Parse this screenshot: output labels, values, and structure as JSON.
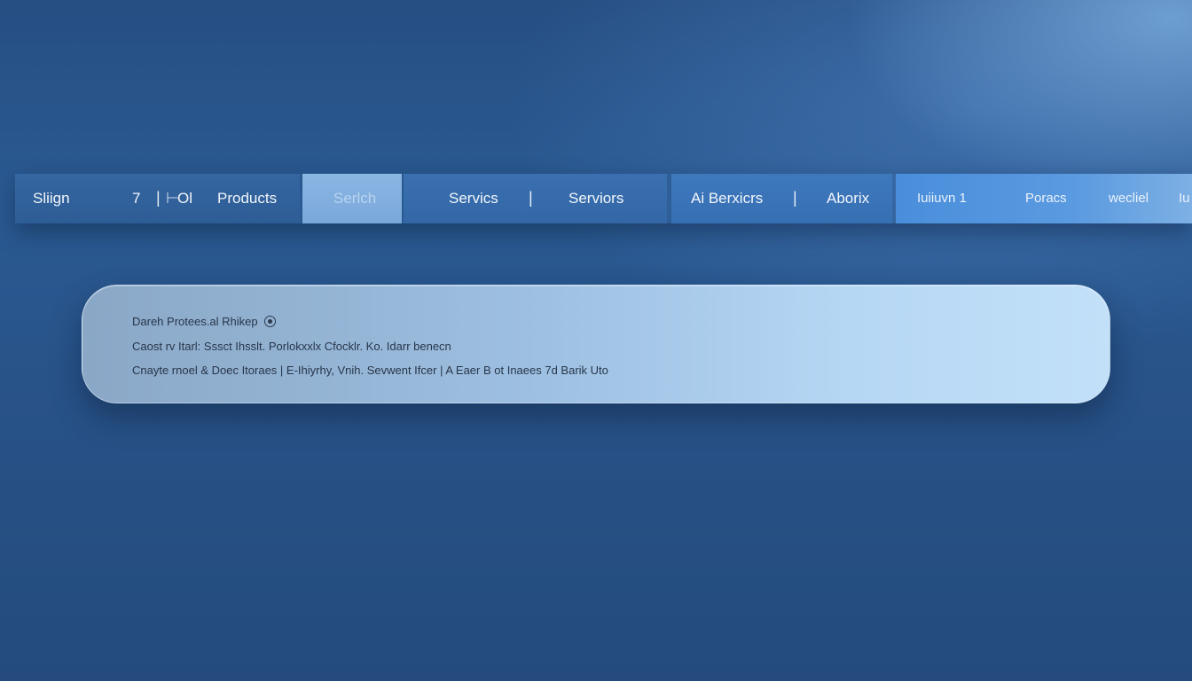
{
  "nav": {
    "seg1": {
      "sign": "Sliign",
      "mark_a": "7",
      "sep_a": "|",
      "mark_b": "⊢",
      "mark_c": "Ol",
      "products": "Products"
    },
    "seg2": {
      "search": "Serlch"
    },
    "seg3": {
      "services": "Servics",
      "sep": "|",
      "services2": "Serviors"
    },
    "seg4": {
      "ai_services": "Ai Berxicrs",
      "sep": "|",
      "about": "Aborix"
    },
    "seg5": {
      "item1": "Iuiiuvn 1",
      "item2": "Poracs",
      "item3": "wecliel",
      "item4": "Iu"
    }
  },
  "panel": {
    "line1": "Dareh Protees.al Rhikep",
    "line2": "Caost rv Itarl:  Sssct Ihsslt.  Porlokxxlx Cfocklr.  Ko.  Idarr benecn",
    "line3": "Cnayte rnoel  & Doec Itoraes  |  E-Ihiyrhy, Vnih.  Sevwent  Ifcer  |  A Eaer B ot Inaees  7d Barik Uto"
  },
  "colors": {
    "background": "#2a5a92",
    "nav_dark": "#2e5d96",
    "nav_active": "#7aa8da",
    "nav_light": "#4a8edb",
    "panel": "#a6c7e8",
    "panel_text": "#28364a"
  },
  "icons": [
    "target-icon"
  ]
}
